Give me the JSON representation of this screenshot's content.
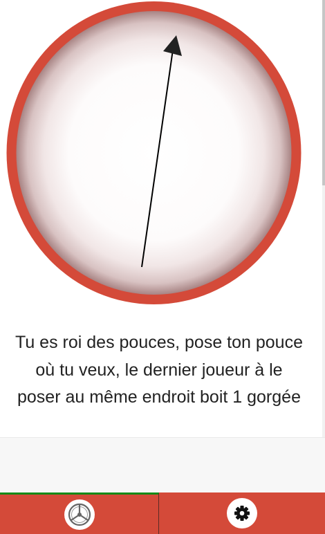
{
  "game": {
    "rule_text": "Tu es roi des pouces, pose ton pouce où tu veux, le dernier joueur à le poser au même endroit boit 1 gorgée",
    "wheel_color": "#d44a39",
    "arrow_color": "#000000"
  },
  "nav": {
    "active_tab": "game",
    "background_color": "#d44a39",
    "active_indicator_color": "#138a18",
    "items": [
      {
        "id": "game",
        "icon": "spinner-wheel-icon"
      },
      {
        "id": "settings",
        "icon": "gear-icon"
      }
    ]
  }
}
